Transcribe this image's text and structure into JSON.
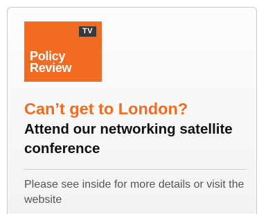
{
  "logo": {
    "badge": "TV",
    "line1": "Policy",
    "line2": "Review"
  },
  "headline": "Can’t get to London?",
  "subhead": "Attend our networking satellite conference",
  "details": "Please see inside for more details or visit the website",
  "colors": {
    "accent": "#f26b21",
    "badge_bg": "#3a3a3a",
    "subhead_text": "#111111",
    "details_text": "#555555"
  }
}
